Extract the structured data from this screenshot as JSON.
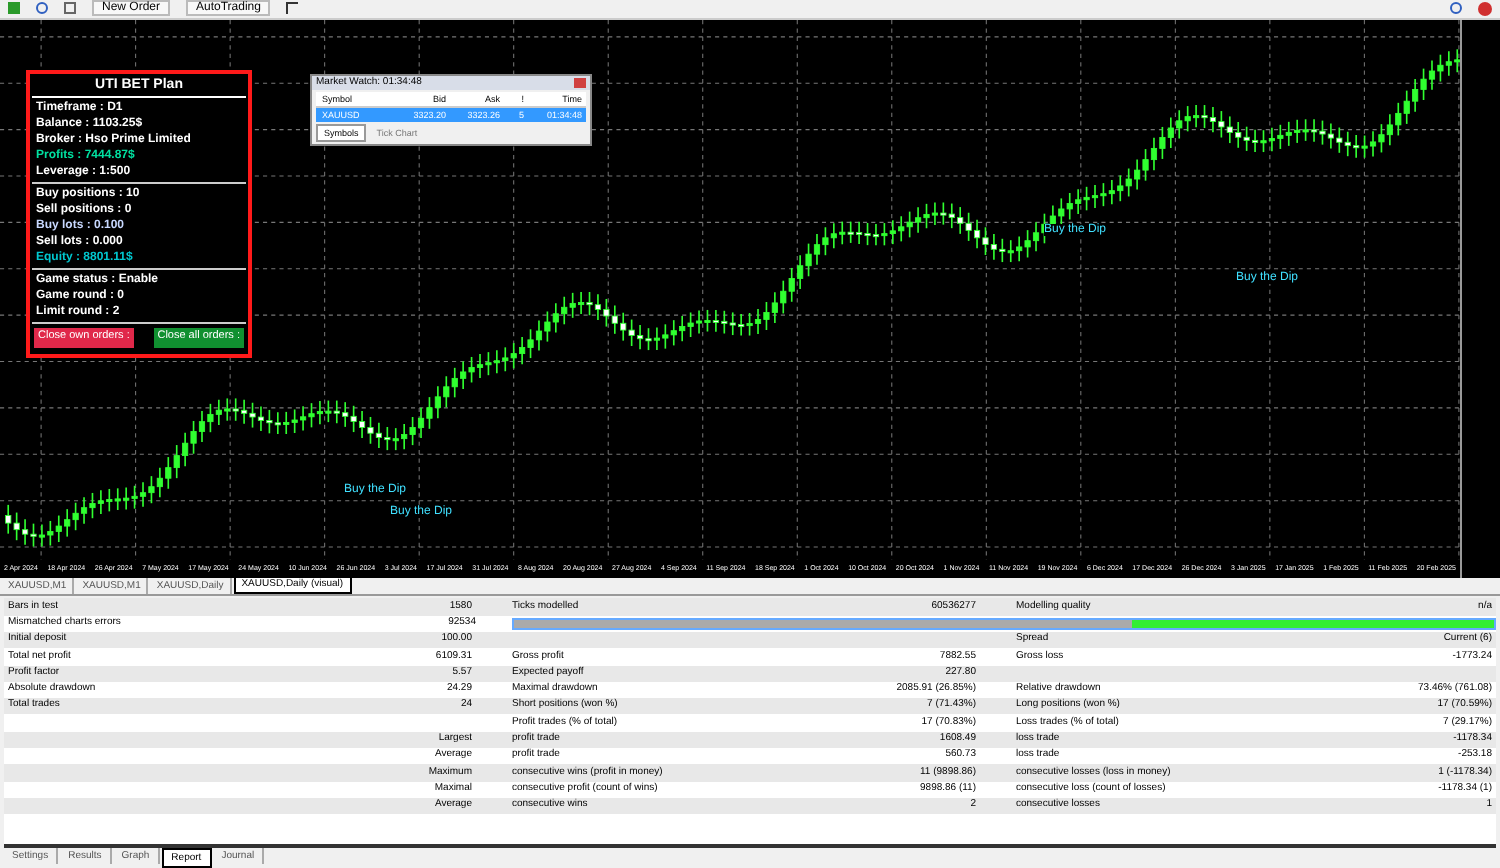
{
  "toolbar": {
    "buttons": [
      {
        "label": "New Order"
      },
      {
        "label": "AutoTrading"
      }
    ]
  },
  "panel": {
    "title": "UTI BET Plan",
    "sections": [
      [
        {
          "text": "Timeframe : D1",
          "color": "#ffffff"
        },
        {
          "text": "Balance : 1103.25$",
          "color": "#ffffff"
        },
        {
          "text": "Broker : Hso Prime Limited",
          "color": "#ffffff"
        },
        {
          "text": "Profits : 7444.87$",
          "color": "#00e0a0"
        },
        {
          "text": "Leverage : 1:500",
          "color": "#ffffff"
        }
      ],
      [
        {
          "text": "Buy positions : 10",
          "color": "#ffffff"
        },
        {
          "text": "Sell positions : 0",
          "color": "#ffffff"
        },
        {
          "text": "Buy lots : 0.100",
          "color": "#c8d8ff"
        },
        {
          "text": "Sell lots : 0.000",
          "color": "#ffffff"
        },
        {
          "text": "Equity : 8801.11$",
          "color": "#00c8d0"
        }
      ],
      [
        {
          "text": "Game status : Enable",
          "color": "#ffffff"
        },
        {
          "text": "Game round : 0",
          "color": "#ffffff"
        },
        {
          "text": "Limit round : 2",
          "color": "#ffffff"
        }
      ]
    ],
    "buttons": [
      {
        "label": "Close own orders :",
        "color": "#e0284a"
      },
      {
        "label": "Close all orders :",
        "color": "#109030"
      }
    ]
  },
  "market_watch": {
    "title": "Market Watch: 01:34:48",
    "columns": [
      "Symbol",
      "Bid",
      "Ask",
      "!",
      "Time"
    ],
    "rows": [
      {
        "cells": [
          "XAUUSD",
          "3323.20",
          "3323.26",
          "5",
          "01:34:48"
        ],
        "selected": true
      }
    ],
    "tabs": [
      {
        "label": "Symbols",
        "selected": true
      },
      {
        "label": "Tick Chart",
        "selected": false
      }
    ]
  },
  "chart": {
    "annotations": [
      "Buy the Dip",
      "Buy the Dip",
      "Buy the Dip",
      "Buy the Dip"
    ],
    "dates": [
      "2 Apr 2024",
      "18 Apr 2024",
      "26 Apr 2024",
      "7 May 2024",
      "17 May 2024",
      "24 May 2024",
      "10 Jun 2024",
      "26 Jun 2024",
      "3 Jul 2024",
      "17 Jul 2024",
      "31 Jul 2024",
      "8 Aug 2024",
      "20 Aug 2024",
      "27 Aug 2024",
      "4 Sep 2024",
      "11 Sep 2024",
      "18 Sep 2024",
      "1 Oct 2024",
      "10 Oct 2024",
      "20 Oct 2024",
      "1 Nov 2024",
      "11 Nov 2024",
      "19 Nov 2024",
      "6 Dec 2024",
      "17 Dec 2024",
      "26 Dec 2024",
      "3 Jan 2025",
      "17 Jan 2025",
      "1 Feb 2025",
      "11 Feb 2025",
      "20 Feb 2025"
    ]
  },
  "chart_tabs": [
    {
      "label": "XAUUSD,M1",
      "selected": false
    },
    {
      "label": "XAUUSD,M1",
      "selected": false
    },
    {
      "label": "XAUUSD,Daily",
      "selected": false
    },
    {
      "label": "XAUUSD,Daily (visual)",
      "selected": true
    }
  ],
  "report": {
    "rows": [
      {
        "kind": "cells",
        "cells": [
          "Bars in test",
          "1580",
          "Ticks modelled",
          "60536277",
          "Modelling quality",
          "n/a"
        ]
      },
      {
        "kind": "bar",
        "cells": [
          "Mismatched charts errors",
          "92534"
        ],
        "level": 0.37
      },
      {
        "kind": "cells",
        "cells": [
          "Initial deposit",
          "100.00",
          null,
          null,
          "Spread",
          "Current (6)"
        ]
      },
      {
        "kind": "cells",
        "cells": [
          "Total net profit",
          "6109.31",
          "Gross profit",
          "7882.55",
          "Gross loss",
          "-1773.24"
        ]
      },
      {
        "kind": "cells",
        "cells": [
          "Profit factor",
          "5.57",
          "Expected payoff",
          "227.80",
          null,
          null
        ]
      },
      {
        "kind": "cells",
        "cells": [
          "Absolute drawdown",
          "24.29",
          "Maximal drawdown",
          "2085.91 (26.85%)",
          "Relative drawdown",
          "73.46% (761.08)"
        ]
      },
      {
        "kind": "cells",
        "cells": [
          "Total trades",
          "24",
          "Short positions (won %)",
          "7 (71.43%)",
          "Long positions (won %)",
          "17 (70.59%)"
        ]
      },
      {
        "kind": "cells",
        "cells": [
          null,
          null,
          "Profit trades (% of total)",
          "17 (70.83%)",
          "Loss trades (% of total)",
          "7 (29.17%)"
        ]
      },
      {
        "kind": "cells",
        "cells": [
          null,
          "Largest",
          "profit trade",
          "1608.49",
          "loss trade",
          "-1178.34"
        ]
      },
      {
        "kind": "cells",
        "cells": [
          null,
          "Average",
          "profit trade",
          "560.73",
          "loss trade",
          "-253.18"
        ]
      },
      {
        "kind": "cells",
        "cells": [
          null,
          "Maximum",
          "consecutive wins (profit in money)",
          "11 (9898.86)",
          "consecutive losses (loss in money)",
          "1 (-1178.34)"
        ]
      },
      {
        "kind": "cells",
        "cells": [
          null,
          "Maximal",
          "consecutive profit (count of wins)",
          "9898.86 (11)",
          "consecutive loss (count of losses)",
          "-1178.34 (1)"
        ]
      },
      {
        "kind": "cells",
        "cells": [
          null,
          "Average",
          "consecutive wins",
          "2",
          "consecutive losses",
          "1"
        ]
      }
    ]
  },
  "bottom_tabs": [
    {
      "label": "Settings",
      "selected": false
    },
    {
      "label": "Results",
      "selected": false
    },
    {
      "label": "Graph",
      "selected": false
    },
    {
      "label": "Report",
      "selected": true
    },
    {
      "label": "Journal",
      "selected": false
    }
  ]
}
